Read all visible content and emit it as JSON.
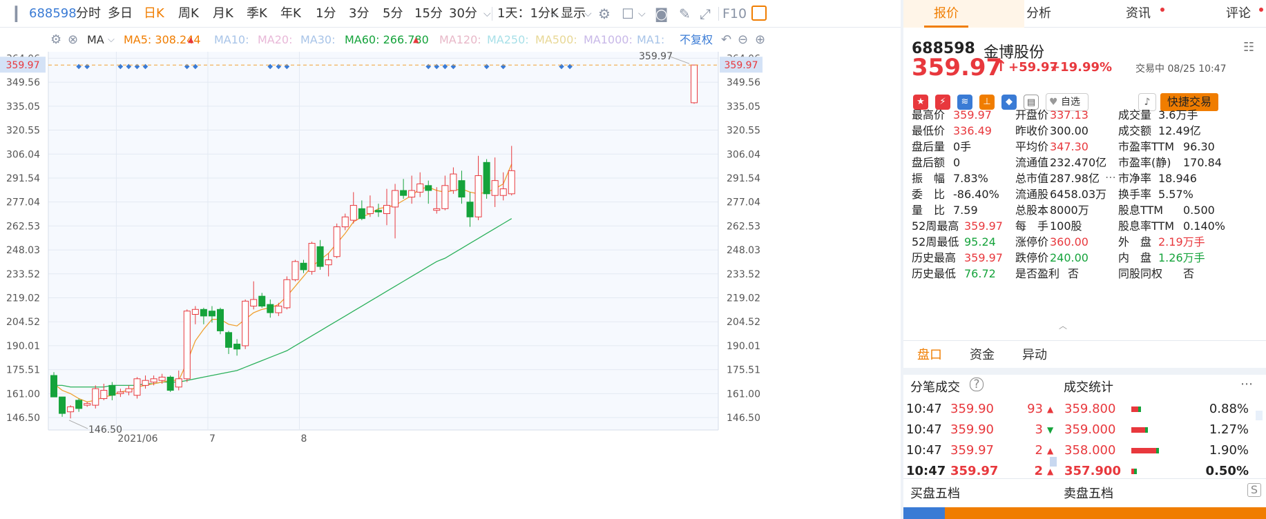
{
  "toolbar": {
    "code": "688598",
    "items": [
      "分时",
      "多日",
      "日K",
      "周K",
      "月K",
      "季K",
      "年K",
      "1分",
      "3分",
      "5分",
      "15分",
      "30分"
    ],
    "active": "日K",
    "period_select": "1天：1分K",
    "display_select": "显示",
    "f10": "F10"
  },
  "indicator_bar": {
    "type": "MA",
    "ma5": "MA5: 308.244",
    "ma10": "MA10:",
    "ma20": "MA20:",
    "ma30": "MA30:",
    "ma60": "MA60: 266.780",
    "ma120": "MA120:",
    "ma250": "MA250:",
    "ma500": "MA500:",
    "ma1000": "MA1000:",
    "ma1": "MA1:",
    "adjust": "不复权",
    "colors": {
      "ma5": "#f07d00",
      "ma60": "#15a33b",
      "faded": "#a8c4e8",
      "faded_yellow": "#e8d896"
    }
  },
  "chart_data": {
    "type": "candlestick",
    "y_ticks": [
      "146.50",
      "161.00",
      "175.51",
      "190.01",
      "204.52",
      "219.02",
      "233.52",
      "248.03",
      "262.53",
      "277.04",
      "291.54",
      "306.04",
      "320.55",
      "335.05",
      "349.56",
      "364.06"
    ],
    "ylim": [
      139,
      368
    ],
    "x_labels": [
      {
        "label": "2021/06",
        "index": 8
      },
      {
        "label": "7",
        "index": 19
      },
      {
        "label": "8",
        "index": 30
      }
    ],
    "current_price_label": "359.97",
    "high_annotation": "359.97",
    "low_annotation": "146.50",
    "candles": [
      [
        172,
        159,
        174,
        159
      ],
      [
        159,
        149,
        159,
        147
      ],
      [
        150,
        153,
        154,
        146
      ],
      [
        157,
        152,
        158,
        150
      ],
      [
        154,
        155,
        156,
        153
      ],
      [
        154,
        164,
        166,
        152
      ],
      [
        158,
        163,
        167,
        157
      ],
      [
        166,
        160,
        168,
        157
      ],
      [
        161,
        162,
        164,
        159
      ],
      [
        162,
        164,
        166,
        160
      ],
      [
        160,
        170,
        171,
        158
      ],
      [
        166,
        169,
        172,
        164
      ],
      [
        168,
        170,
        172,
        166
      ],
      [
        169,
        171,
        173,
        167
      ],
      [
        171,
        163,
        172,
        162
      ],
      [
        165,
        170,
        175,
        163
      ],
      [
        170,
        211,
        212,
        168
      ],
      [
        209,
        212,
        214,
        203
      ],
      [
        212,
        208,
        213,
        203
      ],
      [
        211,
        208,
        214,
        204
      ],
      [
        212,
        199,
        213,
        197
      ],
      [
        198,
        189,
        199,
        185
      ],
      [
        191,
        188,
        194,
        184
      ],
      [
        190,
        217,
        218,
        188
      ],
      [
        214,
        218,
        229,
        212
      ],
      [
        220,
        214,
        222,
        213
      ],
      [
        215,
        210,
        218,
        207
      ],
      [
        210,
        214,
        216,
        208
      ],
      [
        213,
        230,
        232,
        212
      ],
      [
        230,
        241,
        242,
        229
      ],
      [
        240,
        236,
        242,
        234
      ],
      [
        235,
        252,
        253,
        233
      ],
      [
        250,
        238,
        254,
        236
      ],
      [
        239,
        242,
        246,
        232
      ],
      [
        244,
        262,
        264,
        243
      ],
      [
        262,
        268,
        270,
        260
      ],
      [
        266,
        275,
        283,
        264
      ],
      [
        273,
        267,
        278,
        266
      ],
      [
        270,
        274,
        281,
        268
      ],
      [
        272,
        271,
        276,
        268
      ],
      [
        270,
        275,
        285,
        263
      ],
      [
        274,
        284,
        288,
        255
      ],
      [
        284,
        281,
        291,
        279
      ],
      [
        280,
        284,
        293,
        276
      ],
      [
        283,
        288,
        295,
        280
      ],
      [
        287,
        284,
        290,
        276
      ],
      [
        272,
        273,
        286,
        270
      ],
      [
        273,
        287,
        293,
        272
      ],
      [
        284,
        294,
        298,
        282
      ],
      [
        290,
        280,
        296,
        276
      ],
      [
        277,
        268,
        283,
        262
      ],
      [
        268,
        293,
        305,
        266
      ],
      [
        301,
        282,
        303,
        279
      ],
      [
        281,
        290,
        304,
        274
      ],
      [
        281,
        285,
        295,
        278
      ],
      [
        282,
        296,
        311,
        281
      ]
    ],
    "ma5": [
      167,
      163,
      161,
      158,
      156,
      157,
      159,
      160,
      162,
      163,
      165,
      166,
      167,
      168,
      169,
      169,
      180,
      193,
      200,
      206,
      206,
      203,
      202,
      206,
      210,
      212,
      213,
      215,
      220,
      226,
      232,
      238,
      242,
      246,
      252,
      258,
      265,
      268,
      270,
      273,
      274,
      275,
      278,
      281,
      285,
      286,
      284,
      283,
      284,
      285,
      283,
      282,
      283,
      285,
      288,
      300
    ],
    "ma60": [
      166,
      166,
      165,
      165,
      165,
      165,
      165,
      166,
      166,
      166,
      166,
      167,
      167,
      168,
      168,
      168,
      169,
      170,
      171,
      172,
      173,
      174,
      175,
      177,
      179,
      181,
      183,
      185,
      187,
      190,
      193,
      196,
      199,
      202,
      205,
      208,
      211,
      214,
      217,
      220,
      223,
      226,
      229,
      232,
      235,
      238,
      241,
      243,
      246,
      249,
      252,
      255,
      258,
      261,
      264,
      267
    ],
    "colors": {
      "up": "#e8383d",
      "down": "#15a33b",
      "ma5": "#f0a030",
      "ma60": "#2ab05a"
    }
  },
  "quote": {
    "code": "688598",
    "name": "金博股份",
    "price": "359.97",
    "change": "+59.97",
    "change_pct": "+19.99%",
    "status": "交易中 08/25 10:47",
    "watch": "自选",
    "trade": "快捷交易",
    "col1": [
      {
        "label": "最高价",
        "value": "359.97",
        "color": "red"
      },
      {
        "label": "最低价",
        "value": "336.49",
        "color": "red"
      },
      {
        "label": "盘后量",
        "value": "0手",
        "color": "dark"
      },
      {
        "label": "盘后额",
        "value": "0",
        "color": "dark"
      },
      {
        "label": "振　幅",
        "value": "7.83%",
        "color": "dark"
      },
      {
        "label": "委　比",
        "value": "-86.40%",
        "color": "dark"
      },
      {
        "label": "量　比",
        "value": "7.59",
        "color": "dark"
      },
      {
        "label": "52周最高",
        "value": "359.97",
        "color": "red"
      },
      {
        "label": "52周最低",
        "value": "95.24",
        "color": "green"
      },
      {
        "label": "历史最高",
        "value": "359.97",
        "color": "red"
      },
      {
        "label": "历史最低",
        "value": "76.72",
        "color": "green"
      }
    ],
    "col2": [
      {
        "label": "开盘价",
        "value": "337.13",
        "color": "red"
      },
      {
        "label": "昨收价",
        "value": "300.00",
        "color": "dark"
      },
      {
        "label": "平均价",
        "value": "347.30",
        "color": "red"
      },
      {
        "label": "流通值",
        "value": "232.470亿",
        "color": "dark"
      },
      {
        "label": "总市值",
        "value": "287.98亿",
        "color": "dark"
      },
      {
        "label": "流通股",
        "value": "6458.03万",
        "color": "dark"
      },
      {
        "label": "总股本",
        "value": "8000万",
        "color": "dark"
      },
      {
        "label": "每　手",
        "value": "100股",
        "color": "dark"
      },
      {
        "label": "涨停价",
        "value": "360.00",
        "color": "red"
      },
      {
        "label": "跌停价",
        "value": "240.00",
        "color": "green"
      },
      {
        "label": "是否盈利",
        "value": "否",
        "color": "dark"
      }
    ],
    "col3": [
      {
        "label": "成交量",
        "value": "3.6万手",
        "color": "dark"
      },
      {
        "label": "成交额",
        "value": "12.49亿",
        "color": "dark"
      },
      {
        "label": "市盈率TTM",
        "value": "96.30",
        "color": "dark"
      },
      {
        "label": "市盈率(静)",
        "value": "170.84",
        "color": "dark"
      },
      {
        "label": "市净率",
        "value": "18.946",
        "color": "dark"
      },
      {
        "label": "换手率",
        "value": "5.57%",
        "color": "dark"
      },
      {
        "label": "股息TTM",
        "value": "0.500",
        "color": "dark"
      },
      {
        "label": "股息率TTM",
        "value": "0.140%",
        "color": "dark"
      },
      {
        "label": "外　盘",
        "value": "2.19万手",
        "color": "red"
      },
      {
        "label": "内　盘",
        "value": "1.26万手",
        "color": "green"
      },
      {
        "label": "同股同权",
        "value": "否",
        "color": "dark"
      }
    ]
  },
  "tabs": {
    "quote": "报价",
    "analysis": "分析",
    "news": "资讯",
    "comment": "评论"
  },
  "subtabs": {
    "pankou": "盘口",
    "funds": "资金",
    "anomaly": "异动"
  },
  "ticks": {
    "title": "分笔成交",
    "stats_title": "成交统计",
    "rows": [
      {
        "time": "10:47",
        "price": "359.90",
        "vol": "93",
        "dir": "up"
      },
      {
        "time": "10:47",
        "price": "359.90",
        "vol": "3",
        "dir": "down"
      },
      {
        "time": "10:47",
        "price": "359.97",
        "vol": "2",
        "dir": "up"
      },
      {
        "time": "10:47",
        "price": "359.97",
        "vol": "2",
        "dir": "up"
      }
    ],
    "stats": [
      {
        "price": "359.800",
        "pct": "0.88%"
      },
      {
        "price": "359.000",
        "pct": "1.27%"
      },
      {
        "price": "358.000",
        "pct": "1.90%"
      },
      {
        "price": "357.900",
        "pct": "0.50%"
      }
    ]
  },
  "depth": {
    "buy_title": "买盘五档",
    "sell_title": "卖盘五档"
  }
}
